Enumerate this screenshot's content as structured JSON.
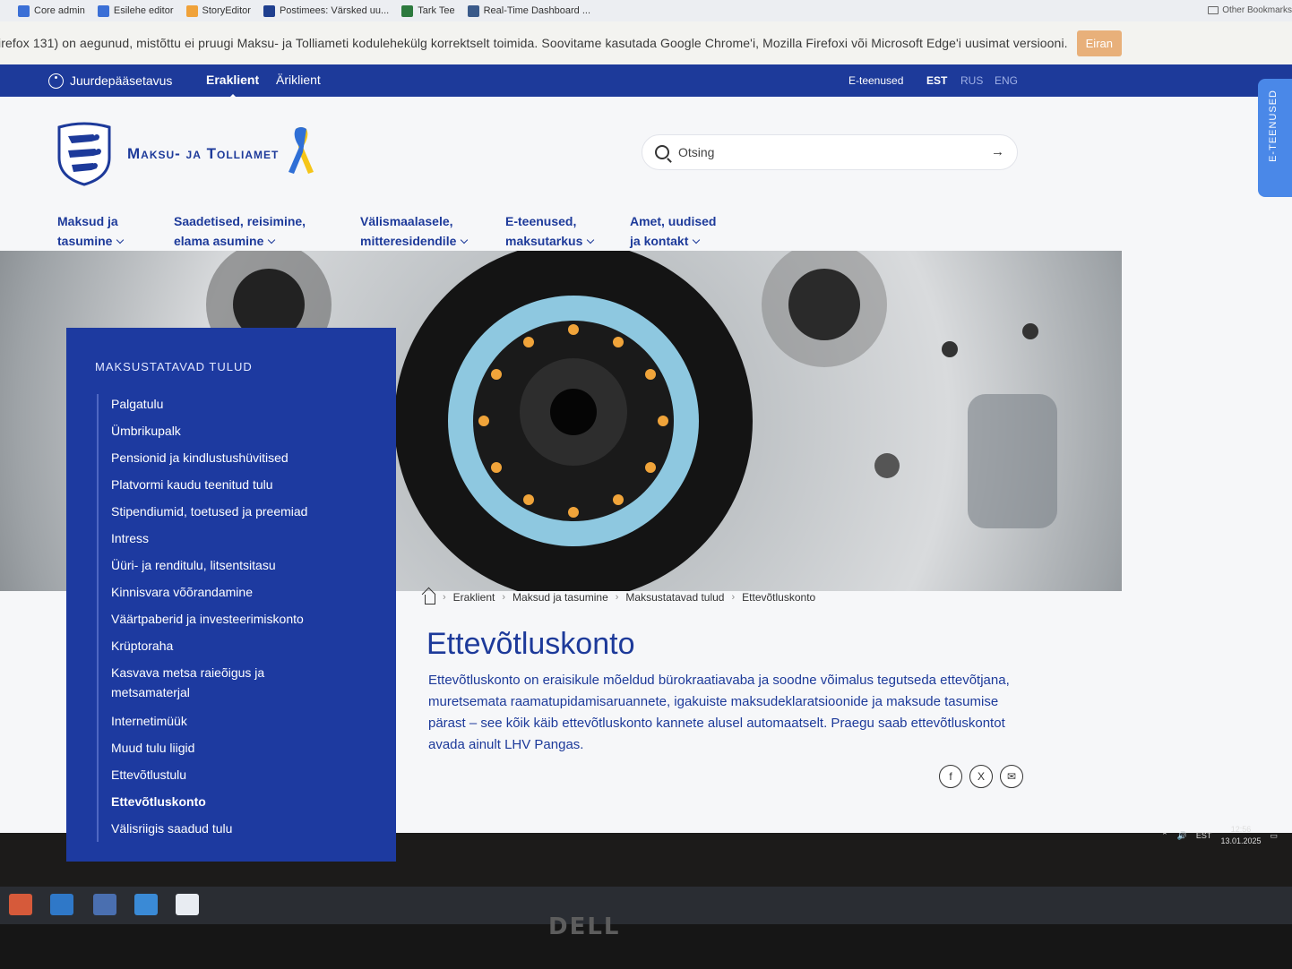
{
  "bookmarks": [
    "Core admin",
    "Esilehe editor",
    "StoryEditor",
    "Postimees: Värsked uu...",
    "Tark Tee",
    "Real-Time Dashboard ..."
  ],
  "bookmarks_other": "Other Bookmarks",
  "warning": {
    "text": "irefox 131) on aegunud, mistõttu ei pruugi Maksu- ja Tolliameti kodulehekülg korrektselt toimida. Soovitame kasutada Google Chrome'i, Mozilla Firefoxi või Microsoft Edge'i uusimat versiooni.",
    "button": "Eiran"
  },
  "topnav": {
    "accessibility": "Juurdepääsetavus",
    "tabs": [
      "Eraklient",
      "Äriklient"
    ],
    "eservices": "E-teenused",
    "langs": [
      "EST",
      "RUS",
      "ENG"
    ]
  },
  "header": {
    "brand": "Maksu- ja Tolliamet",
    "search_placeholder": "Otsing",
    "etab": "E-TEENUSED"
  },
  "mainnav": [
    {
      "line1": "Maksud ja",
      "line2": "tasumine"
    },
    {
      "line1": "Saadetised, reisimine,",
      "line2": "elama asumine"
    },
    {
      "line1": "Välismaalasele,",
      "line2": "mitteresidendile"
    },
    {
      "line1": "E-teenused,",
      "line2": "maksutarkus"
    },
    {
      "line1": "Amet, uudised",
      "line2": "ja kontakt"
    }
  ],
  "sidebar": {
    "title": "MAKSUSTATAVAD TULUD",
    "items": [
      "Palgatulu",
      "Ümbrikupalk",
      "Pensionid ja kindlustushüvitised",
      "Platvormi kaudu teenitud tulu",
      "Stipendiumid, toetused ja preemiad",
      "Intress",
      "Üüri- ja renditulu, litsentsitasu",
      "Kinnisvara võõrandamine",
      "Väärtpaberid ja investeerimiskonto",
      "Krüptoraha",
      "Kasvava metsa raieõigus ja metsamaterjal",
      "Internetimüük",
      "Muud tulu liigid",
      "Ettevõtlustulu",
      "Ettevõtluskonto",
      "Välisriigis saadud tulu"
    ],
    "current_index": 14
  },
  "breadcrumb": [
    "Eraklient",
    "Maksud ja tasumine",
    "Maksustatavad tulud",
    "Ettevõtluskonto"
  ],
  "content": {
    "title": "Ettevõtluskonto",
    "intro": "Ettevõtluskonto on eraisikule mõeldud bürokraatiavaba ja soodne võimalus tegutseda ettevõtjana, muretsemata raamatupidamisaruannete, igakuiste maksudeklaratsioonide ja maksude tasumise pärast – see kõik käib ettevõtluskonto kannete alusel automaatselt. Praegu saab ettevõtluskontot avada ainult LHV Pangas."
  },
  "tray": {
    "lang": "EST",
    "time": "12:56",
    "date": "13.01.2025"
  },
  "monitor_brand": "DELL",
  "colors": {
    "primary": "#1d3a9a",
    "sidebar": "#1d3aa0",
    "etab": "#4a88e8",
    "warning_btn": "#e8b07a"
  }
}
